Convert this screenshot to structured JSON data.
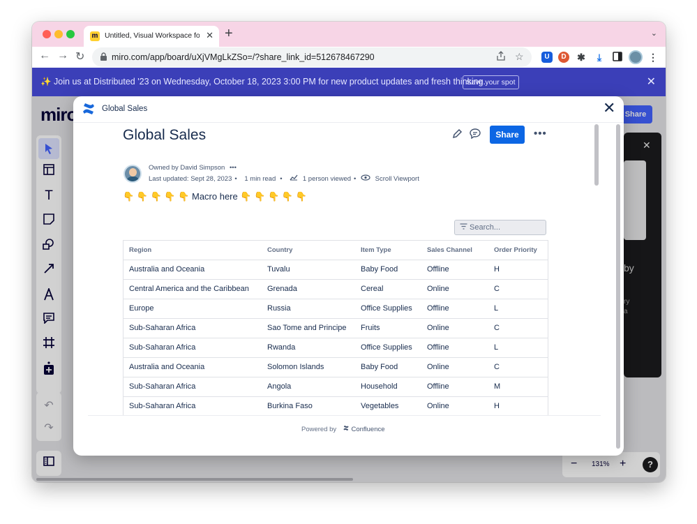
{
  "browser": {
    "tab_title": "Untitled, Visual Workspace for",
    "tab_close": "✕",
    "new_tab": "+",
    "tab_menu": "⌄",
    "back": "←",
    "forward": "→",
    "reload": "↻",
    "url": "miro.com/app/board/uXjVMgLkZSo=/?share_link_id=512678467290",
    "favicon_letter": "m"
  },
  "banner": {
    "text": "✨ Join us at Distributed '23 on Wednesday, October 18, 2023 3:00 PM for new product updates and fresh thinking.",
    "button": "Save your spot",
    "close": "✕"
  },
  "miro": {
    "logo": "miro",
    "share": "Share",
    "zoom_level": "131%",
    "zoom_out": "−",
    "zoom_in": "+",
    "help": "?",
    "card_close": "✕",
    "card_text_1": "by",
    "card_text_2": "ry\na",
    "tools": [
      "select",
      "templates",
      "text",
      "sticky-note",
      "shapes",
      "connection-line",
      "pen",
      "comment",
      "frame",
      "add-more"
    ]
  },
  "modal": {
    "header_title": "Global Sales",
    "close": "✕",
    "page_title": "Global Sales",
    "share": "Share",
    "more": "•••",
    "owned_by": "Owned by David Simpson",
    "owned_more": "•••",
    "last_updated": "Last updated: Sept 28, 2023",
    "read_time": "1 min read",
    "viewed": "1 person viewed",
    "scroll_viewport": "Scroll Viewport",
    "macro": "👇 👇 👇 👇 👇 Macro here 👇 👇 👇 👇 👇",
    "search_placeholder": "Search...",
    "powered_prefix": "Powered by",
    "powered_brand": "Confluence"
  },
  "table": {
    "headers": [
      "Region",
      "Country",
      "Item Type",
      "Sales Channel",
      "Order Priority"
    ],
    "rows": [
      [
        "Australia and Oceania",
        "Tuvalu",
        "Baby Food",
        "Offline",
        "H"
      ],
      [
        "Central America and the Caribbean",
        "Grenada",
        "Cereal",
        "Online",
        "C"
      ],
      [
        "Europe",
        "Russia",
        "Office Supplies",
        "Offline",
        "L"
      ],
      [
        "Sub-Saharan Africa",
        "Sao Tome and Principe",
        "Fruits",
        "Online",
        "C"
      ],
      [
        "Sub-Saharan Africa",
        "Rwanda",
        "Office Supplies",
        "Offline",
        "L"
      ],
      [
        "Australia and Oceania",
        "Solomon Islands",
        "Baby Food",
        "Online",
        "C"
      ],
      [
        "Sub-Saharan Africa",
        "Angola",
        "Household",
        "Offline",
        "M"
      ],
      [
        "Sub-Saharan Africa",
        "Burkina Faso",
        "Vegetables",
        "Online",
        "H"
      ]
    ]
  },
  "colors": {
    "banner_bg": "#3b3fb8",
    "tabstrip_bg": "#f7d5e6",
    "confluence_blue": "#0c66e4",
    "miro_blue": "#4262ff"
  }
}
